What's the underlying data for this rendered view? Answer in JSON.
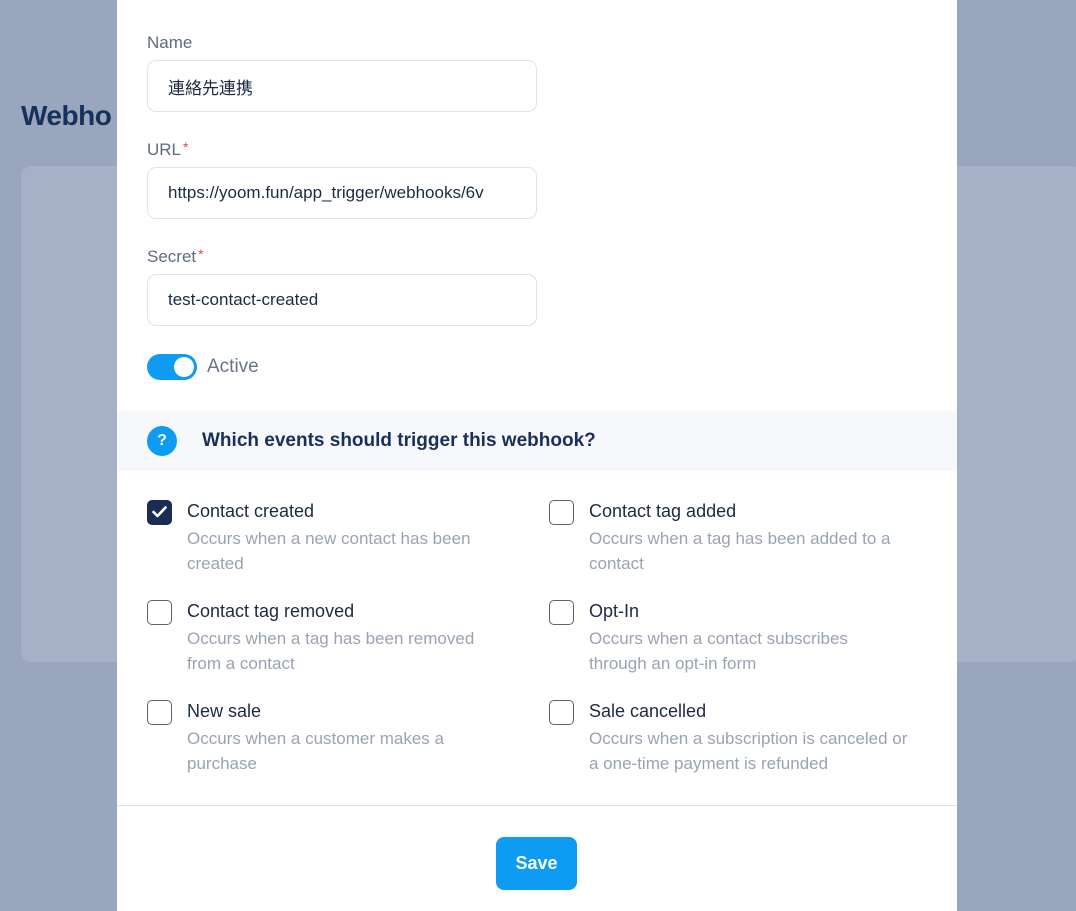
{
  "background": {
    "page_title": "Webho"
  },
  "form": {
    "name": {
      "label": "Name",
      "value": "連絡先連携"
    },
    "url": {
      "label": "URL",
      "required_mark": "*",
      "value": "https://yoom.fun/app_trigger/webhooks/6v"
    },
    "secret": {
      "label": "Secret",
      "required_mark": "*",
      "value": "test-contact-created"
    },
    "active": {
      "label": "Active",
      "on": true
    }
  },
  "events": {
    "help_icon": "question-icon",
    "title": "Which events should trigger this webhook?",
    "items": [
      {
        "title": "Contact created",
        "description": "Occurs when a new contact has been created",
        "checked": true
      },
      {
        "title": "Contact tag added",
        "description": "Occurs when a tag has been added to a contact",
        "checked": false
      },
      {
        "title": "Contact tag removed",
        "description": "Occurs when a tag has been removed from a contact",
        "checked": false
      },
      {
        "title": "Opt-In",
        "description": "Occurs when a contact subscribes through an opt-in form",
        "checked": false
      },
      {
        "title": "New sale",
        "description": "Occurs when a customer makes a purchase",
        "checked": false
      },
      {
        "title": "Sale cancelled",
        "description": "Occurs when a subscription is canceled or a one-time payment is refunded",
        "checked": false
      }
    ]
  },
  "footer": {
    "save_label": "Save"
  },
  "colors": {
    "accent": "#0d9cf2",
    "navy": "#18305c",
    "required": "#e5484d"
  }
}
